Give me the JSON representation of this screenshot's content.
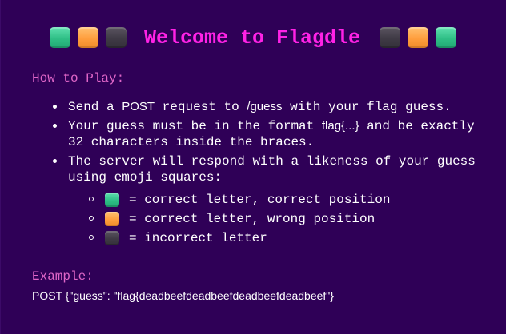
{
  "header": {
    "title": "Welcome to Flagdle",
    "left_squares": [
      "green",
      "orange",
      "dark"
    ],
    "right_squares": [
      "dark",
      "orange",
      "green"
    ]
  },
  "how_to_play": {
    "heading": "How to Play:",
    "item1": {
      "prefix": "Send a ",
      "method": "POST",
      "middle": " request to ",
      "path": "/guess",
      "suffix": " with your flag guess."
    },
    "item2": {
      "prefix": "Your guess must be in the format ",
      "format": "flag{...}",
      "suffix": " and be exactly 32 characters inside the braces."
    },
    "item3": {
      "text": "The server will respond with a likeness of your guess using emoji squares:"
    },
    "legend": [
      {
        "icon": "green-square-icon",
        "text": "= correct letter, correct position"
      },
      {
        "icon": "orange-square-icon",
        "text": "= correct letter, wrong position"
      },
      {
        "icon": "dark-square-icon",
        "text": "= incorrect letter"
      }
    ]
  },
  "example": {
    "heading": "Example:",
    "body": "POST {\"guess\": \"flag{deadbeefdeadbeefdeadbeefdeadbeef\"}"
  },
  "colors": {
    "background": "#2f0057",
    "title": "#ff22e6",
    "heading": "#e066c8",
    "square_green": "#2fbf86",
    "square_orange": "#ff9e3d",
    "square_dark": "#3f3a45"
  }
}
